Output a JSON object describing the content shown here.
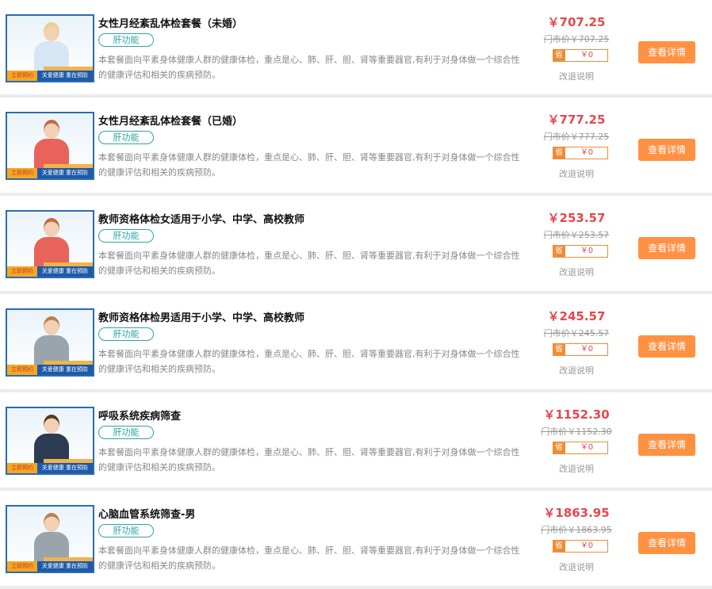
{
  "colors": {
    "accent": "#ff9143",
    "price_red": "#e5484d",
    "tag_teal": "#2aa4a8",
    "banner_blue": "#1e5aa8"
  },
  "packages": [
    {
      "title": "女性月经紊乱体检套餐（未婚）",
      "tag": "肝功能",
      "description": "本套餐面向平素身体健康人群的健康体检，重点是心、肺、肝、胆、肾等重要器官,有利于对身体做一个综合性的健康评估和相关的疾病预防。",
      "price": "￥707.25",
      "market_price": "门市价￥707.25",
      "discount_label": "省",
      "discount_value": "￥0",
      "note": "改退说明",
      "button": "查看详情",
      "thumb": {
        "cta": "立即预约",
        "slogan": "关爱健康  重在预防",
        "figure": "woman-blonde-glasses",
        "hair": "#e8d18a",
        "shirt": "#d6e6f4",
        "skin": "#f2d0b5"
      }
    },
    {
      "title": "女性月经紊乱体检套餐（已婚）",
      "tag": "肝功能",
      "description": "本套餐面向平素身体健康人群的健康体检，重点是心、肺、肝、胆、肾等重要器官,有利于对身体做一个综合性的健康评估和相关的疾病预防。",
      "price": "￥777.25",
      "market_price": "门市价￥777.25",
      "discount_label": "省",
      "discount_value": "￥0",
      "note": "改退说明",
      "button": "查看详情",
      "thumb": {
        "cta": "立即预约",
        "slogan": "关爱健康  重在预防",
        "figure": "woman-redhead-phone",
        "hair": "#c46a3c",
        "shirt": "#e8645a",
        "skin": "#f2d0b5"
      }
    },
    {
      "title": "教师资格体检女适用于小学、中学、高校教师",
      "tag": "肝功能",
      "description": "本套餐面向平素身体健康人群的健康体检，重点是心、肺、肝、胆、肾等重要器官,有利于对身体做一个综合性的健康评估和相关的疾病预防。",
      "price": "￥253.57",
      "market_price": "门市价￥253.57",
      "discount_label": "省",
      "discount_value": "￥0",
      "note": "改退说明",
      "button": "查看详情",
      "thumb": {
        "cta": "立即预约",
        "slogan": "关爱健康  重在预防",
        "figure": "woman-redhead-phone",
        "hair": "#c46a3c",
        "shirt": "#e8645a",
        "skin": "#f2d0b5"
      }
    },
    {
      "title": "教师资格体检男适用于小学、中学、高校教师",
      "tag": "肝功能",
      "description": "本套餐面向平素身体健康人群的健康体检，重点是心、肺、肝、胆、肾等重要器官,有利于对身体做一个综合性的健康评估和相关的疾病预防。",
      "price": "￥245.57",
      "market_price": "门市价￥245.57",
      "discount_label": "省",
      "discount_value": "￥0",
      "note": "改退说明",
      "button": "查看详情",
      "thumb": {
        "cta": "立即预约",
        "slogan": "关爱健康  重在预防",
        "figure": "boy-grey-shirt",
        "hair": "#b8824a",
        "shirt": "#9aa4ad",
        "skin": "#f2d0b5"
      }
    },
    {
      "title": "呼吸系统疾病筛查",
      "tag": "肝功能",
      "description": "本套餐面向平素身体健康人群的健康体检，重点是心、肺、肝、胆、肾等重要器官,有利于对身体做一个综合性的健康评估和相关的疾病预防。",
      "price": "￥1152.30",
      "market_price": "门市价￥1152.30",
      "discount_label": "省",
      "discount_value": "￥0",
      "note": "改退说明",
      "button": "查看详情",
      "thumb": {
        "cta": "立即预约",
        "slogan": "关爱健康  重在预防",
        "figure": "business-couple",
        "hair": "#5a3a22",
        "shirt": "#2e3b55",
        "skin": "#f2d0b5"
      }
    },
    {
      "title": "心脑血管系统筛查-男",
      "tag": "肝功能",
      "description": "本套餐面向平素身体健康人群的健康体检，重点是心、肺、肝、胆、肾等重要器官,有利于对身体做一个综合性的健康评估和相关的疾病预防。",
      "price": "￥1863.95",
      "market_price": "门市价￥1863.95",
      "discount_label": "省",
      "discount_value": "￥0",
      "note": "改退说明",
      "button": "查看详情",
      "thumb": {
        "cta": "立即预约",
        "slogan": "关爱健康  重在预防",
        "figure": "boy-grey-shirt",
        "hair": "#b8824a",
        "shirt": "#9aa4ad",
        "skin": "#f2d0b5"
      }
    }
  ]
}
